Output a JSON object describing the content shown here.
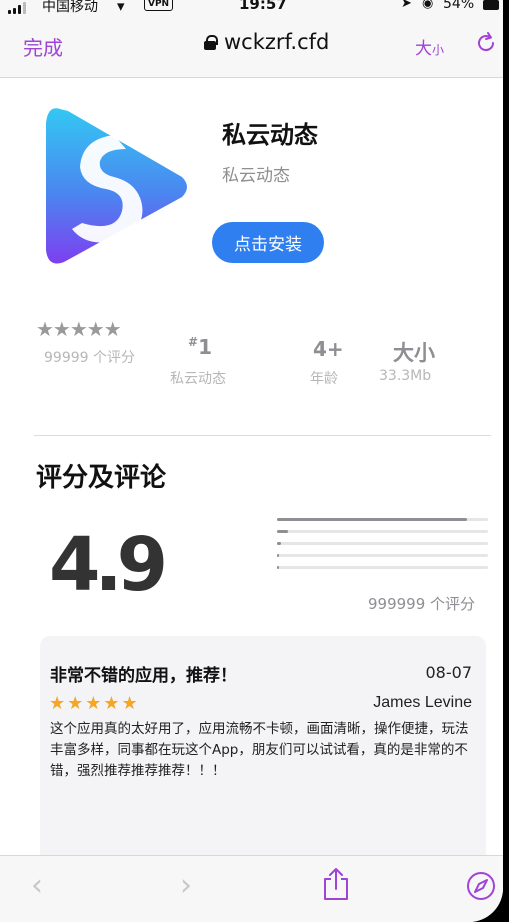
{
  "status_bar": {
    "carrier": "中国移动",
    "vpn": "VPN",
    "time": "19:57",
    "battery": "54%"
  },
  "browser": {
    "done": "完成",
    "url": "wckzrf.cfd",
    "text_size_big": "大",
    "text_size_small": "小"
  },
  "app": {
    "name": "私云动态",
    "subtitle": "私云动态",
    "install": "点击安装"
  },
  "stats": {
    "stars": "★★★★★",
    "ratings_count": "99999 个评分",
    "rank_hash": "#",
    "rank": "1",
    "rank_label": "私云动态",
    "age": "4+",
    "age_label": "年龄",
    "size_title": "大小",
    "size_value": "33.3Mb"
  },
  "ratings": {
    "title": "评分及评论",
    "score": "4.9",
    "total": "999999 个评分",
    "distribution": [
      0.9,
      0.05,
      0.02,
      0.01,
      0.01
    ]
  },
  "review": {
    "title": "非常不错的应用，推荐！",
    "date": "08-07",
    "stars": "★★★★★",
    "author": "James Levine",
    "body": "这个应用真的太好用了，应用流畅不卡顿，画面清晰，操作便捷，玩法丰富多样，同事都在玩这个App，朋友们可以试试看，真的是非常的不错，强烈推荐推荐推荐！！！"
  },
  "colors": {
    "accent": "#a044d6",
    "install_button": "#2f7ff0",
    "star_orange": "#f5a623"
  },
  "icons": [
    "lock-icon",
    "reload-icon",
    "back-chevron-icon",
    "forward-chevron-icon",
    "share-icon",
    "compass-icon",
    "wifi-icon",
    "location-icon"
  ]
}
